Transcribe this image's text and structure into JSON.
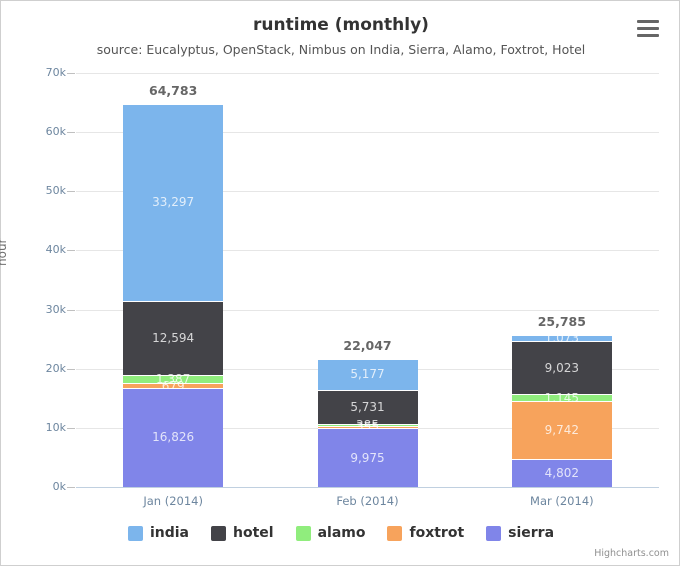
{
  "chart_data": {
    "type": "bar",
    "title": "runtime (monthly)",
    "subtitle": "source: Eucalyptus, OpenStack, Nimbus on India, Sierra, Alamo, Foxtrot, Hotel",
    "xlabel": "",
    "ylabel": "hour",
    "ylim": [
      0,
      70000
    ],
    "grid": true,
    "legend_position": "bottom",
    "stacked": true,
    "categories": [
      "Jan (2014)",
      "Feb (2014)",
      "Mar (2014)"
    ],
    "y_ticks": [
      {
        "value": 0,
        "label": "0k"
      },
      {
        "value": 10000,
        "label": "10k"
      },
      {
        "value": 20000,
        "label": "20k"
      },
      {
        "value": 30000,
        "label": "30k"
      },
      {
        "value": 40000,
        "label": "40k"
      },
      {
        "value": 50000,
        "label": "50k"
      },
      {
        "value": 60000,
        "label": "60k"
      },
      {
        "value": 70000,
        "label": "70k"
      }
    ],
    "series": [
      {
        "name": "india",
        "color": "#7CB5EC",
        "values": [
          33297,
          5177,
          1073
        ],
        "labels": [
          "33,297",
          "5,177",
          "1,073"
        ]
      },
      {
        "name": "hotel",
        "color": "#434348",
        "values": [
          12594,
          5731,
          9023
        ],
        "labels": [
          "12,594",
          "5,731",
          "9,023"
        ]
      },
      {
        "name": "alamo",
        "color": "#90ED7D",
        "values": [
          1387,
          385,
          1145
        ],
        "labels": [
          "1,387",
          "385",
          "1,145"
        ]
      },
      {
        "name": "foxtrot",
        "color": "#F7A35C",
        "values": [
          679,
          355,
          9742
        ],
        "labels": [
          "679",
          "355",
          "9,742"
        ]
      },
      {
        "name": "sierra",
        "color": "#8085E9",
        "values": [
          16826,
          9975,
          4802
        ],
        "labels": [
          "16,826",
          "9,975",
          "4,802"
        ]
      }
    ],
    "totals": [
      64783,
      22047,
      25785
    ],
    "total_labels": [
      "64,783",
      "22,047",
      "25,785"
    ]
  },
  "export": {
    "menu_icon": "hamburger-menu-icon"
  },
  "credits": {
    "text": "Highcharts.com"
  }
}
